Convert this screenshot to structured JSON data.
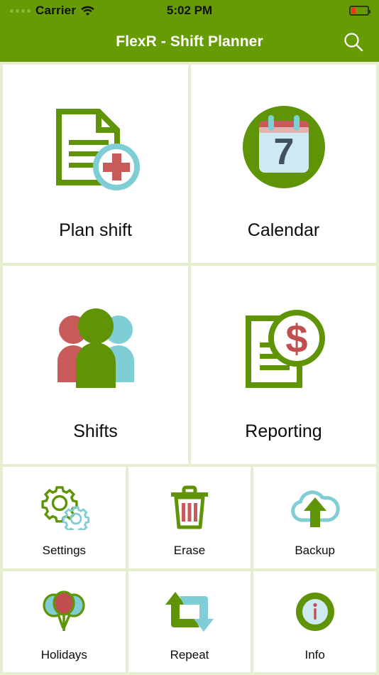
{
  "status_bar": {
    "carrier": "Carrier",
    "time": "5:02 PM",
    "signal_icon": "signal-dots-icon",
    "wifi_icon": "wifi-icon",
    "battery_icon": "battery-low-icon"
  },
  "nav_bar": {
    "title": "FlexR - Shift Planner",
    "search_icon": "search-icon"
  },
  "colors": {
    "brand_green": "#669b03",
    "icon_green": "#5f9406",
    "teal": "#7fcdd5",
    "red": "#c85a5a",
    "divider": "#e6eed0",
    "tile_bg": "#ffffff"
  },
  "main_tiles": [
    {
      "label": "Plan shift",
      "icon": "document-add-icon"
    },
    {
      "label": "Calendar",
      "icon": "calendar-icon"
    },
    {
      "label": "Shifts",
      "icon": "people-group-icon"
    },
    {
      "label": "Reporting",
      "icon": "document-dollar-icon"
    }
  ],
  "utility_tiles": [
    {
      "label": "Settings",
      "icon": "gears-icon"
    },
    {
      "label": "Erase",
      "icon": "trash-icon"
    },
    {
      "label": "Backup",
      "icon": "cloud-upload-icon"
    },
    {
      "label": "Holidays",
      "icon": "balloons-icon"
    },
    {
      "label": "Repeat",
      "icon": "repeat-arrows-icon"
    },
    {
      "label": "Info",
      "icon": "info-circle-icon"
    }
  ]
}
